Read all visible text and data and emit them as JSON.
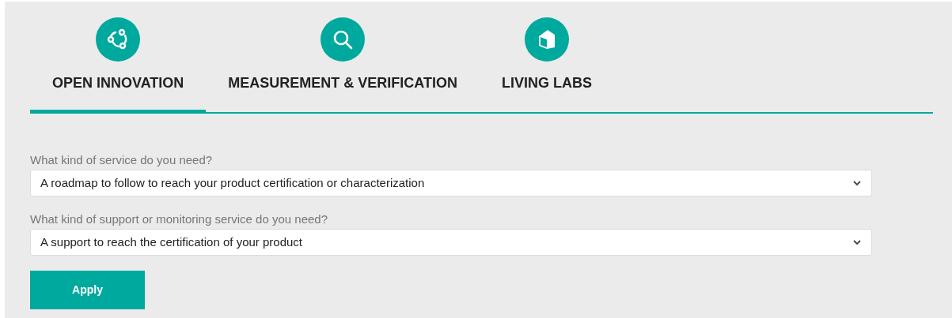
{
  "tabs": [
    {
      "label": "OPEN INNOVATION",
      "kind": "network",
      "selected": true
    },
    {
      "label": "MEASUREMENT & VERIFICATION",
      "kind": "search",
      "selected": false
    },
    {
      "label": "LIVING LABS",
      "kind": "house",
      "selected": false
    }
  ],
  "fields": [
    {
      "label": "What kind of service do you need?",
      "value": "A roadmap to follow to reach your product certification or characterization"
    },
    {
      "label": "What kind of support or monitoring service do you need?",
      "value": "A support to reach the certification of your product"
    }
  ],
  "button": "Apply"
}
